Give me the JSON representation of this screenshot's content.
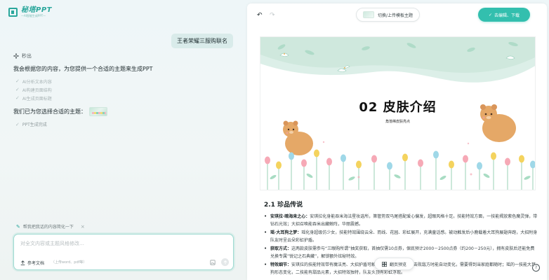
{
  "app": {
    "logo_name": "秘塔PPT",
    "logo_sub": "—AI智能生成PPT—"
  },
  "chat": {
    "user_message": "王者荣耀三服购联名",
    "status_label": "秒出",
    "ai_intro": "我会根据您的内容，为您提供一个合适的主题来生成PPT",
    "steps": [
      "AI分析文本内容",
      "AI构建页面结构",
      "AI生成页面标题"
    ],
    "theme_prefix": "我们已为您选择合适的主题：",
    "done_label": "PPT生成完成"
  },
  "composer": {
    "chip_label": "帮我把我话的内容简化一下",
    "placeholder": "对全文内容或主题风格修改…",
    "ref_doc_label": "参考文档",
    "ref_doc_hint": "（上传word、pdf等）"
  },
  "toolbar": {
    "switch_theme_label": "切换/上传模板主题",
    "edit_download_label": "去编辑、下载"
  },
  "slide": {
    "title": "02 皮肤介绍",
    "subtitle": "角落稀皮肤亮点"
  },
  "section": {
    "title": "2.1 珍品传说",
    "bullets": [
      {
        "head": "安琪拉·暗海来之心：",
        "text": "安琪拉化身能吞米海法星妆选所，第管势双马尾搭配爱心偏发，超眼风格十足。技能特效方面，一技能揭放紫色魔灵弹，带钻石光效；大招召唤能吞米出藏鲸阵，华丽震撼。"
      },
      {
        "head": "瑶·大耳狗之梦：",
        "text": "瑶化身超级仿少女，技能特效围绕云朵、而线、花园、彩虹展开，充满童话感。被动触发后小鹿载着大耳狗展翅奔跑，大招附身队友时呈云朵彩虹护盾。"
      },
      {
        "head": "获取方式：",
        "text": "这两款皮肤需参与“三眼购所谓”抽奖获取，首抽仅需10点券，保底预计2000－2500点券（约200－250元），拥有皮肤后还能免费兑换专属“锐记之石典藏”，解锁额外炫秘特效。"
      },
      {
        "head": "特效细节：",
        "text": "安琪拉的技能特效带有魔法亮、大招护盾可触发星光反应，并且在击败敌方时能自动变化，需要得到当家庭都随时；瑶的一技能大耳狗形态变化，二技能有甜品元素，大招特效独特，队友头顶有彩虹浮现。"
      }
    ]
  },
  "preview_label": "翻页预览",
  "help_label": "?"
}
